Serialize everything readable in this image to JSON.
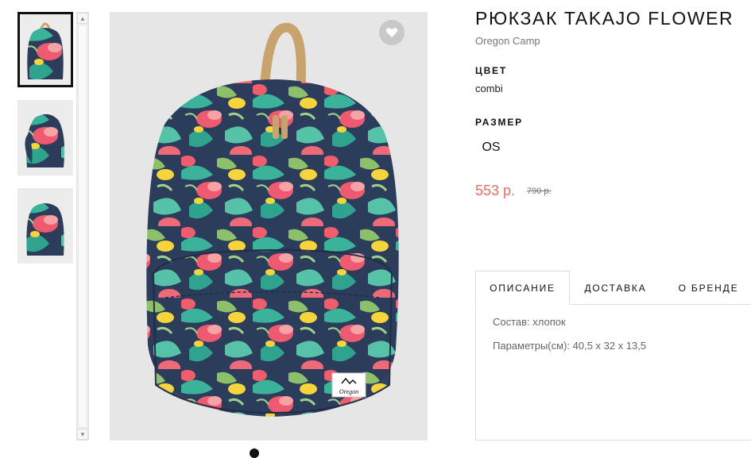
{
  "product": {
    "title": "РЮКЗАК TAKAJO FLOWER",
    "brand": "Oregon Camp",
    "color_label": "ЦВЕТ",
    "color_value": "combi",
    "size_label": "РАЗМЕР",
    "size_option": "OS",
    "price": "553 р.",
    "old_price": "790 р."
  },
  "tabs": [
    {
      "label": "ОПИСАНИЕ"
    },
    {
      "label": "ДОСТАВКА"
    },
    {
      "label": "О БРЕНДЕ"
    }
  ],
  "description": {
    "composition": "Состав: хлопок",
    "parameters": "Параметры(см): 40,5 х 32 х 13,5"
  },
  "photo": {
    "label_text": "Oregon"
  },
  "colors": {
    "accent_price": "#e56f67",
    "wish_circle": "#c8c8c8"
  },
  "icons": {
    "wishlist": "heart-icon",
    "scroll_up": "chevron-up-icon",
    "scroll_down": "chevron-down-icon"
  }
}
